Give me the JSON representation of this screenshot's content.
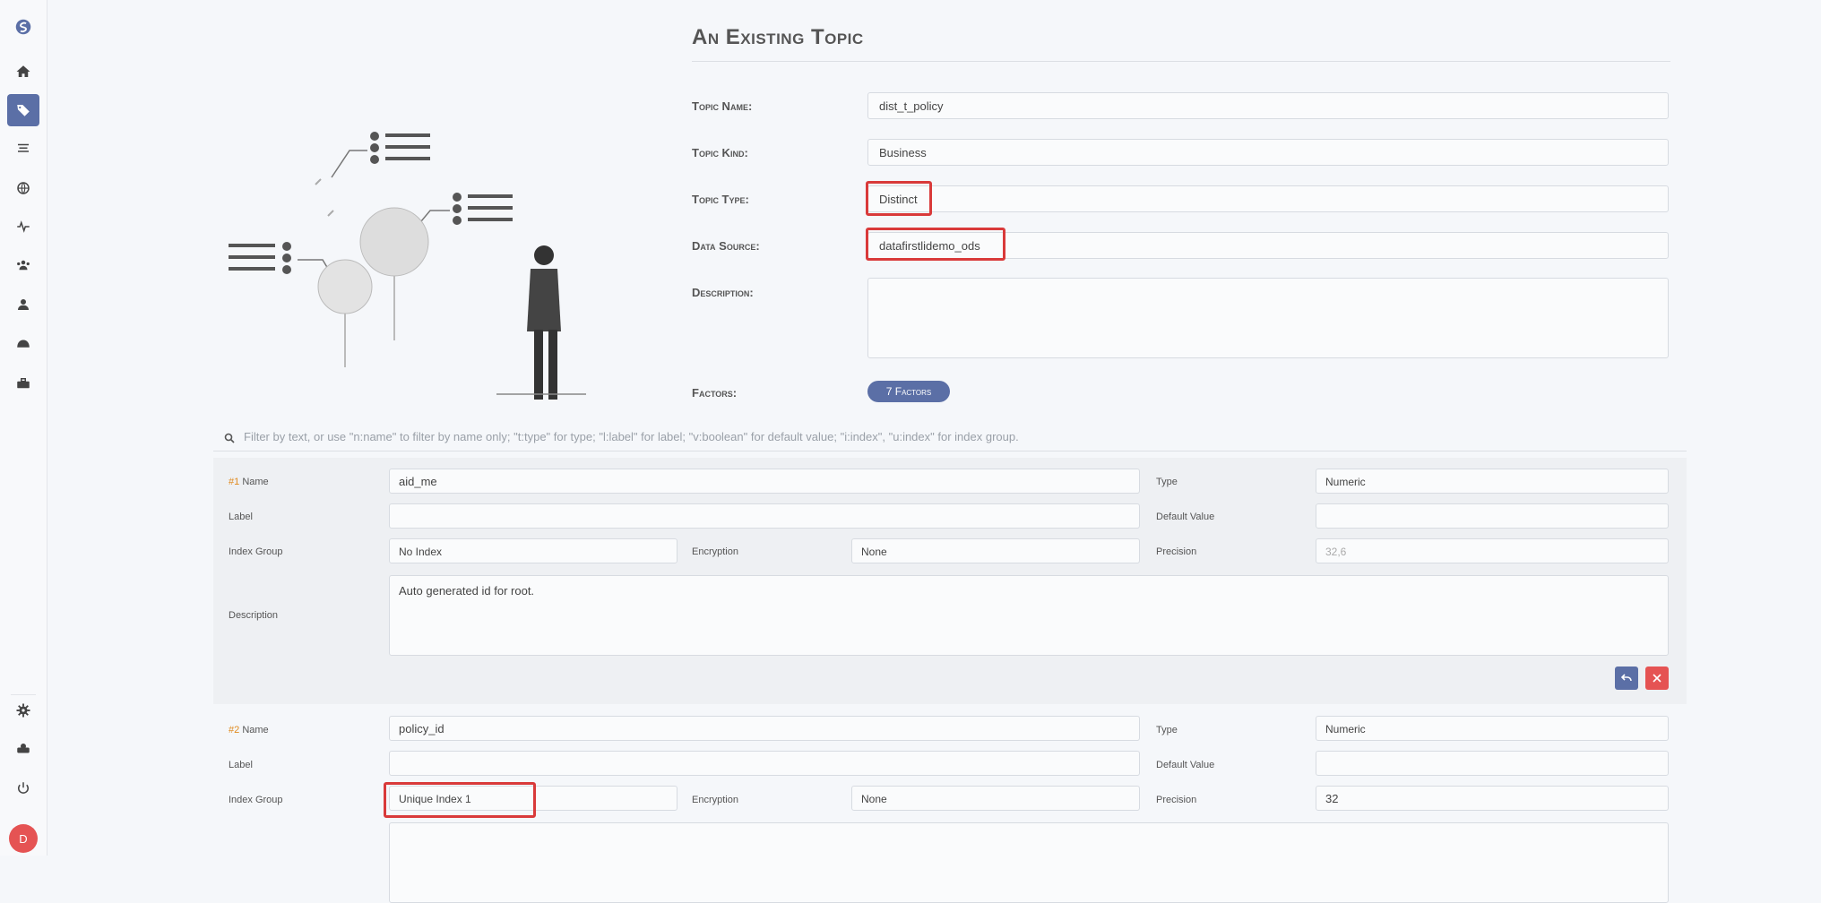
{
  "page": {
    "title": "An Existing Topic"
  },
  "topic": {
    "name_label": "Topic Name:",
    "name_value": "dist_t_policy",
    "kind_label": "Topic Kind:",
    "kind_value": "Business",
    "type_label": "Topic Type:",
    "type_value": "Distinct",
    "source_label": "Data Source:",
    "source_value": "datafirstlidemo_ods",
    "description_label": "Description:",
    "description_value": "",
    "factors_label": "Factors:",
    "factors_badge": "7 Factors"
  },
  "filter": {
    "placeholder": "Filter by text, or use \"n:name\" to filter by name only; \"t:type\" for type; \"l:label\" for label; \"v:boolean\" for default value; \"i:index\", \"u:index\" for index group."
  },
  "factors": [
    {
      "index": "#1",
      "name_label": "Name",
      "name": "aid_me",
      "type_label": "Type",
      "type": "Numeric",
      "label_label": "Label",
      "label": "",
      "default_label": "Default Value",
      "default": "",
      "index_group_label": "Index Group",
      "index_group": "No Index",
      "encryption_label": "Encryption",
      "encryption": "None",
      "precision_label": "Precision",
      "precision": "32,6",
      "description_label": "Description",
      "description": "Auto generated id for root."
    },
    {
      "index": "#2",
      "name_label": "Name",
      "name": "policy_id",
      "type_label": "Type",
      "type": "Numeric",
      "label_label": "Label",
      "label": "",
      "default_label": "Default Value",
      "default": "",
      "index_group_label": "Index Group",
      "index_group": "Unique Index 1",
      "encryption_label": "Encryption",
      "encryption": "None",
      "precision_label": "Precision",
      "precision": "32",
      "description_label": "Description",
      "description": ""
    }
  ],
  "user": {
    "avatar_initial": "D"
  },
  "colors": {
    "accent": "#5b6fa6",
    "danger": "#e55353",
    "highlight": "#d93a3a",
    "index_number": "#e08a1e"
  },
  "icons": {
    "sidebar": [
      "logo-icon",
      "home-icon",
      "tag-icon",
      "list-icon",
      "globe-icon",
      "monitor-icon",
      "users-icon",
      "user-icon",
      "pipeline-icon",
      "toolbox-icon",
      "settings-icon",
      "admin-icon",
      "logout-icon"
    ],
    "filter": "search-icon",
    "factor_actions": [
      "undo-icon",
      "close-icon"
    ]
  }
}
